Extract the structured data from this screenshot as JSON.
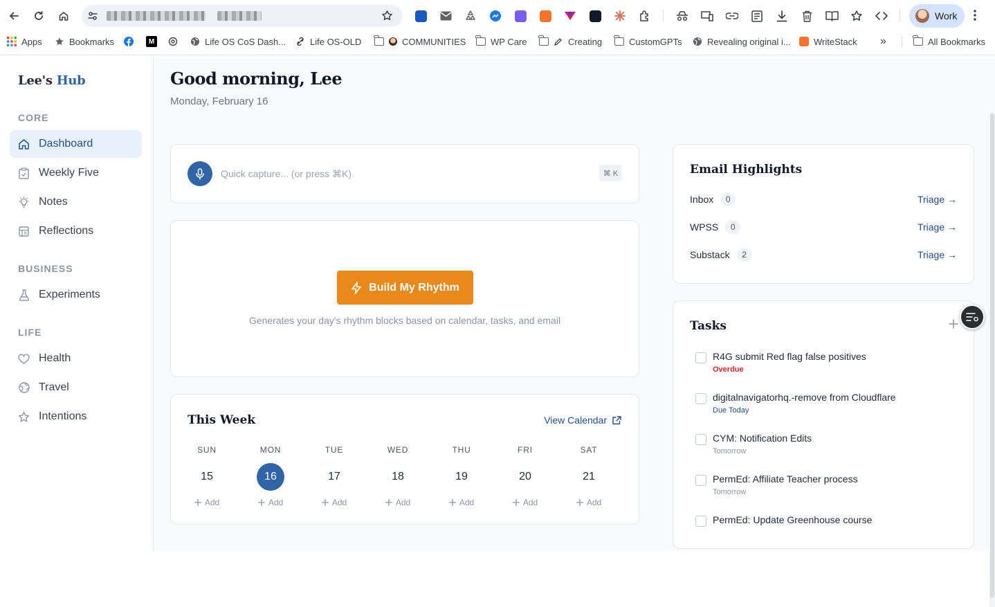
{
  "browser": {
    "profile_label": "Work",
    "bookmarks": [
      {
        "label": "Apps",
        "icon": "apps-grid-icon"
      },
      {
        "label": "Bookmarks",
        "icon": "star-icon"
      },
      {
        "label": "",
        "icon": "facebook-icon"
      },
      {
        "label": "",
        "icon": "medium-icon"
      },
      {
        "label": "",
        "icon": "openai-icon"
      },
      {
        "label": "Life OS CoS Dash...",
        "icon": "globe-icon"
      },
      {
        "label": "Life OS-OLD",
        "icon": "link-icon"
      },
      {
        "label": "COMMUNITIES",
        "icon": "folder-icon"
      },
      {
        "label": "WP Care",
        "icon": "folder-icon"
      },
      {
        "label": "Creating",
        "icon": "folder-icon"
      },
      {
        "label": "CustomGPTs",
        "icon": "folder-icon"
      },
      {
        "label": "Revealing original i...",
        "icon": "globe-icon"
      },
      {
        "label": "WriteStack",
        "icon": "writestack-icon"
      }
    ],
    "more_bookmarks": "»",
    "all_bookmarks": "All Bookmarks"
  },
  "sidebar": {
    "brand_first": "Lee's",
    "brand_second": "Hub",
    "sections": [
      {
        "title": "CORE",
        "items": [
          {
            "label": "Dashboard",
            "icon": "home-icon",
            "active": true
          },
          {
            "label": "Weekly Five",
            "icon": "clipboard-icon"
          },
          {
            "label": "Notes",
            "icon": "lightbulb-icon"
          },
          {
            "label": "Reflections",
            "icon": "journal-icon"
          }
        ]
      },
      {
        "title": "BUSINESS",
        "items": [
          {
            "label": "Experiments",
            "icon": "flask-icon"
          }
        ]
      },
      {
        "title": "LIFE",
        "items": [
          {
            "label": "Health",
            "icon": "heart-icon"
          },
          {
            "label": "Travel",
            "icon": "globe-icon"
          },
          {
            "label": "Intentions",
            "icon": "star-icon"
          }
        ]
      }
    ]
  },
  "header": {
    "greeting": "Good morning, Lee",
    "date": "Monday, February 16"
  },
  "capture": {
    "placeholder": "Quick capture... (or press ⌘K)",
    "shortcut": "⌘ K"
  },
  "rhythm": {
    "button_label": "Build My Rhythm",
    "description": "Generates your day's rhythm blocks based on calendar, tasks, and email"
  },
  "week": {
    "title": "This Week",
    "view_calendar": "View Calendar",
    "add_label": "Add",
    "days": [
      {
        "name": "SUN",
        "date": "15",
        "today": false
      },
      {
        "name": "MON",
        "date": "16",
        "today": true
      },
      {
        "name": "TUE",
        "date": "17",
        "today": false
      },
      {
        "name": "WED",
        "date": "18",
        "today": false
      },
      {
        "name": "THU",
        "date": "19",
        "today": false
      },
      {
        "name": "FRI",
        "date": "20",
        "today": false
      },
      {
        "name": "SAT",
        "date": "21",
        "today": false
      }
    ]
  },
  "email": {
    "title": "Email Highlights",
    "rows": [
      {
        "label": "Inbox",
        "count": "0",
        "action": "Triage →"
      },
      {
        "label": "WPSS",
        "count": "0",
        "action": "Triage →"
      },
      {
        "label": "Substack",
        "count": "2",
        "action": "Triage →"
      }
    ]
  },
  "tasks": {
    "title": "Tasks",
    "items": [
      {
        "title": "R4G submit Red flag false positives",
        "due": "Overdue",
        "due_color": "#dc2626"
      },
      {
        "title": "digitalnavigatorhq.-remove from Cloudflare",
        "due": "Due Today",
        "due_color": "#1e4f85"
      },
      {
        "title": "CYM: Notification Edits",
        "due": "Tomorrow",
        "due_color": "#8a94a6"
      },
      {
        "title": "PermEd: Affiliate Teacher process",
        "due": "Tomorrow",
        "due_color": "#8a94a6"
      },
      {
        "title": "PermEd: Update Greenhouse course",
        "due": "",
        "due_color": "#8a94a6"
      }
    ]
  },
  "colors": {
    "primary": "#2f65a7",
    "accent_orange": "#e8891a",
    "active_nav_bg": "#e8f0f9",
    "overdue": "#dc2626"
  }
}
